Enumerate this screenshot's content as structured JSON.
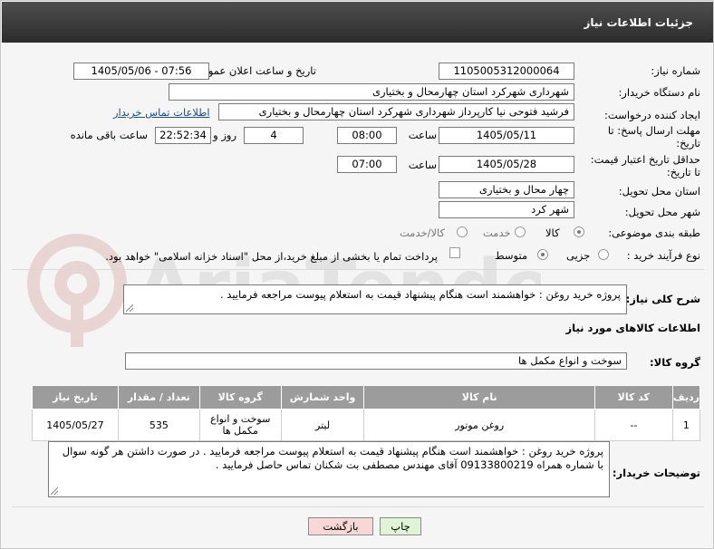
{
  "header": {
    "title": "جزئیات اطلاعات نیاز"
  },
  "form": {
    "need_number_label": "شماره نیاز:",
    "need_number": "1105005312000064",
    "announce_label": "تاریخ و ساعت اعلان عمومی:",
    "announce_value": "1405/05/06 - 07:56",
    "buyer_org_label": "نام دستگاه خریدار:",
    "buyer_org": "شهرداری شهرکرد استان چهارمحال و بختیاری",
    "creator_label": "ایجاد کننده درخواست:",
    "creator": "فرشید فتوحی نیا کارپرداز شهرداری شهرکرد استان چهارمحال و بختیاری",
    "contact_link": "اطلاعات تماس خریدار",
    "deadline_label_1": "مهلت ارسال پاسخ: تا",
    "deadline_label_2": "تاریخ:",
    "deadline_date": "1405/05/11",
    "time_label": "ساعت",
    "deadline_time": "08:00",
    "days_value": "4",
    "days_label": "روز و",
    "remaining_time": "22:52:34",
    "remaining_label": "ساعت باقی مانده",
    "min_validity_label_1": "حداقل تاریخ اعتبار قیمت:",
    "min_validity_label_2": "تا تاریخ:",
    "validity_date": "1405/05/28",
    "validity_time": "07:00",
    "province_label": "استان محل تحویل:",
    "province": "چهار محال و بختیاری",
    "city_label": "شهر محل تحویل:",
    "city": "شهر کرد",
    "category_label": "طبقه بندی موضوعی:",
    "category_options": [
      "کالا",
      "خدمت",
      "کالا/خدمت"
    ],
    "process_label": "نوع فرآیند خرید :",
    "process_options": [
      "جزیی",
      "متوسط"
    ],
    "payment_text": "پرداخت تمام یا بخشی از مبلغ خرید،از محل \"اسناد خزانه اسلامی\" خواهد بود."
  },
  "description": {
    "label": "شرح کلی نیاز:",
    "text": "پروژه خرید روغن : خواهشمند است هنگام پیشنهاد قیمت به استعلام پیوست مراجعه فرمایید ."
  },
  "goods": {
    "section_title": "اطلاعات کالاهای مورد نیاز",
    "group_label": "گروه کالا:",
    "group_value": "سوخت و انواع مکمل ها",
    "columns": [
      "ردیف",
      "کد کالا",
      "نام کالا",
      "واحد شمارش",
      "گروه کالا",
      "تعداد / مقدار",
      "تاریخ نیاز"
    ],
    "rows": [
      {
        "row": "1",
        "code": "--",
        "name": "روغن موتور",
        "unit": "لیتر",
        "group": "سوخت و انواع مکمل ها",
        "qty": "535",
        "date": "1405/05/27"
      }
    ]
  },
  "buyer_notes": {
    "label": "توضیحات خریدار:",
    "text": "پروژه خرید روغن : خواهشمند است هنگام پیشنهاد قیمت به استعلام پیوست مراجعه فرمایید . در صورت داشتن هر گونه سوال با شماره همراه 09133800219 آقای مهندس مصطفی بت شکنان تماس حاصل فرمایید ."
  },
  "buttons": {
    "print": "چاپ",
    "back": "بازگشت"
  },
  "watermark": {
    "brand": "AriaTender.net"
  },
  "colors": {
    "header": "#3a3a3a",
    "link": "#1a4f8f",
    "back_button": "#f8d7d7",
    "print_button": "#dff3d5"
  }
}
